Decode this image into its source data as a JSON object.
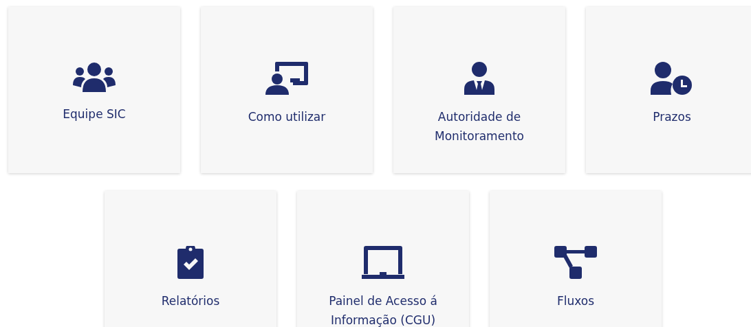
{
  "cards": [
    {
      "label": "Equipe SIC",
      "kind": "group"
    },
    {
      "label": "Como utilizar",
      "kind": "presenter"
    },
    {
      "label": "Autoridade de Monitoramento",
      "kind": "suit"
    },
    {
      "label": "Prazos",
      "kind": "userclock"
    },
    {
      "label": "Relatórios",
      "kind": "clipboard"
    },
    {
      "label": "Painel de Acesso á Informação (CGU)",
      "kind": "laptop"
    },
    {
      "label": "Fluxos",
      "kind": "flow"
    }
  ]
}
